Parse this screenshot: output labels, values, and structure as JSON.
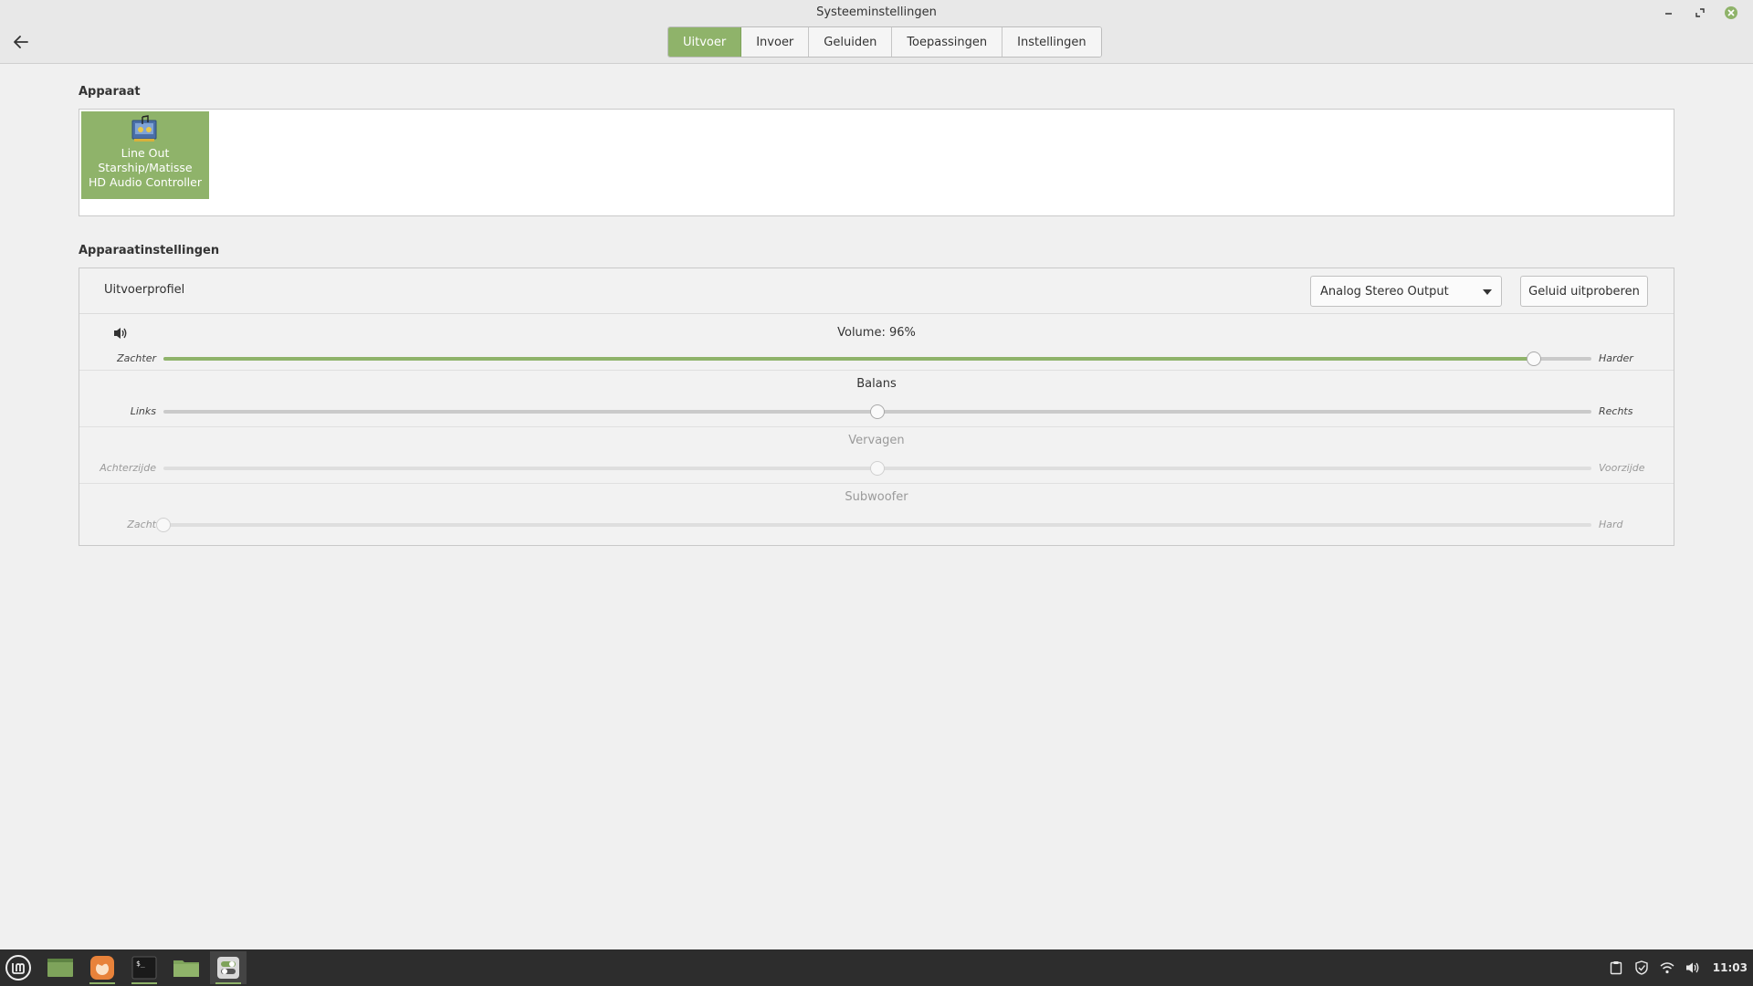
{
  "window": {
    "title": "Systeeminstellingen"
  },
  "tabs": [
    {
      "label": "Uitvoer",
      "active": true
    },
    {
      "label": "Invoer",
      "active": false
    },
    {
      "label": "Geluiden",
      "active": false
    },
    {
      "label": "Toepassingen",
      "active": false
    },
    {
      "label": "Instellingen",
      "active": false
    }
  ],
  "device_section": {
    "title": "Apparaat",
    "device": {
      "line1": "Line Out",
      "line2": "Starship/Matisse",
      "line3": "HD Audio Controller"
    }
  },
  "settings_section": {
    "title": "Apparaatinstellingen",
    "profile_label": "Uitvoerprofiel",
    "profile_value": "Analog Stereo Output",
    "test_button": "Geluid uitproberen",
    "volume": {
      "caption": "Volume: 96%",
      "left": "Zachter",
      "right": "Harder",
      "value": 0.96
    },
    "balance": {
      "caption": "Balans",
      "left": "Links",
      "right": "Rechts",
      "value": 0.5
    },
    "fade": {
      "caption": "Vervagen",
      "left": "Achterzijde",
      "right": "Voorzijde",
      "value": 0.5
    },
    "subwoofer": {
      "caption": "Subwoofer",
      "left": "Zacht",
      "right": "Hard",
      "value": 0.0
    }
  },
  "taskbar": {
    "clock": "11:03"
  },
  "colors": {
    "accent": "#8fb36a",
    "taskbar_bg": "#2d2d2d"
  }
}
